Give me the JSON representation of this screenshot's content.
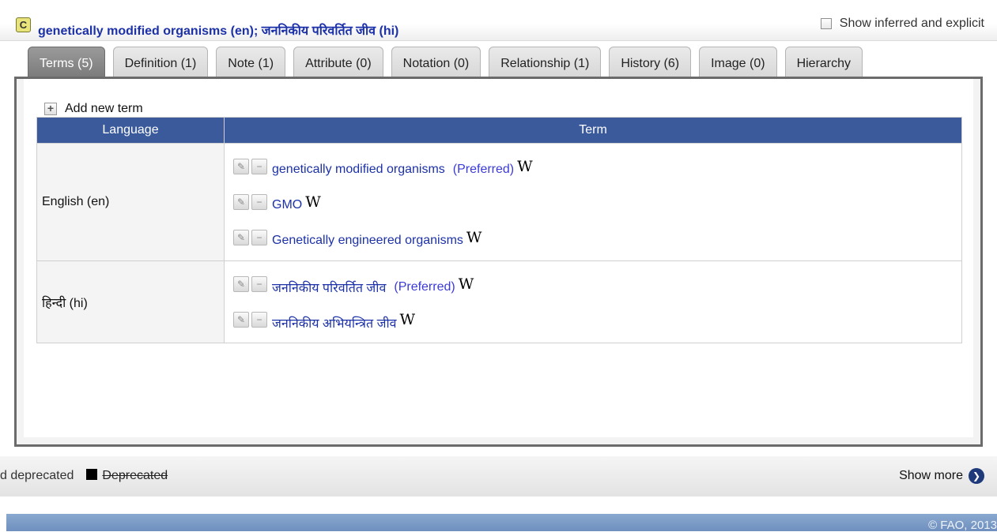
{
  "header": {
    "badge": "C",
    "title": "genetically modified organisms (en); जननिकीय परिवर्तित जीव (hi)",
    "show_inferred_label": "Show inferred and explicit"
  },
  "tabs": [
    {
      "label": "Terms (5)"
    },
    {
      "label": "Definition (1)"
    },
    {
      "label": "Note (1)"
    },
    {
      "label": "Attribute (0)"
    },
    {
      "label": "Notation (0)"
    },
    {
      "label": "Relationship (1)"
    },
    {
      "label": "History (6)"
    },
    {
      "label": "Image (0)"
    },
    {
      "label": "Hierarchy"
    }
  ],
  "add_term_label": "Add new term",
  "table": {
    "columns": [
      "Language",
      "Term"
    ],
    "rows": [
      {
        "language": "English (en)",
        "terms": [
          {
            "text": "genetically modified organisms",
            "preferred": "(Preferred)",
            "wiki": "W"
          },
          {
            "text": "GMO",
            "wiki": "W"
          },
          {
            "text": "Genetically engineered organisms",
            "wiki": "W"
          }
        ]
      },
      {
        "language": "हिन्दी (hi)",
        "terms": [
          {
            "text": "जननिकीय परिवर्तित जीव",
            "preferred": "(Preferred)",
            "wiki": "W"
          },
          {
            "text": "जननिकीय अभियन्त्रित जीव",
            "wiki": "W"
          }
        ]
      }
    ]
  },
  "legend": {
    "fragment": "d deprecated",
    "deprecated": "Deprecated"
  },
  "show_more_label": "Show more",
  "footer": {
    "copyright": "© FAO, 2013"
  },
  "colors": {
    "link": "#1c31a8",
    "table_header": "#3a5a9c",
    "footer": "#6f8fbf"
  }
}
